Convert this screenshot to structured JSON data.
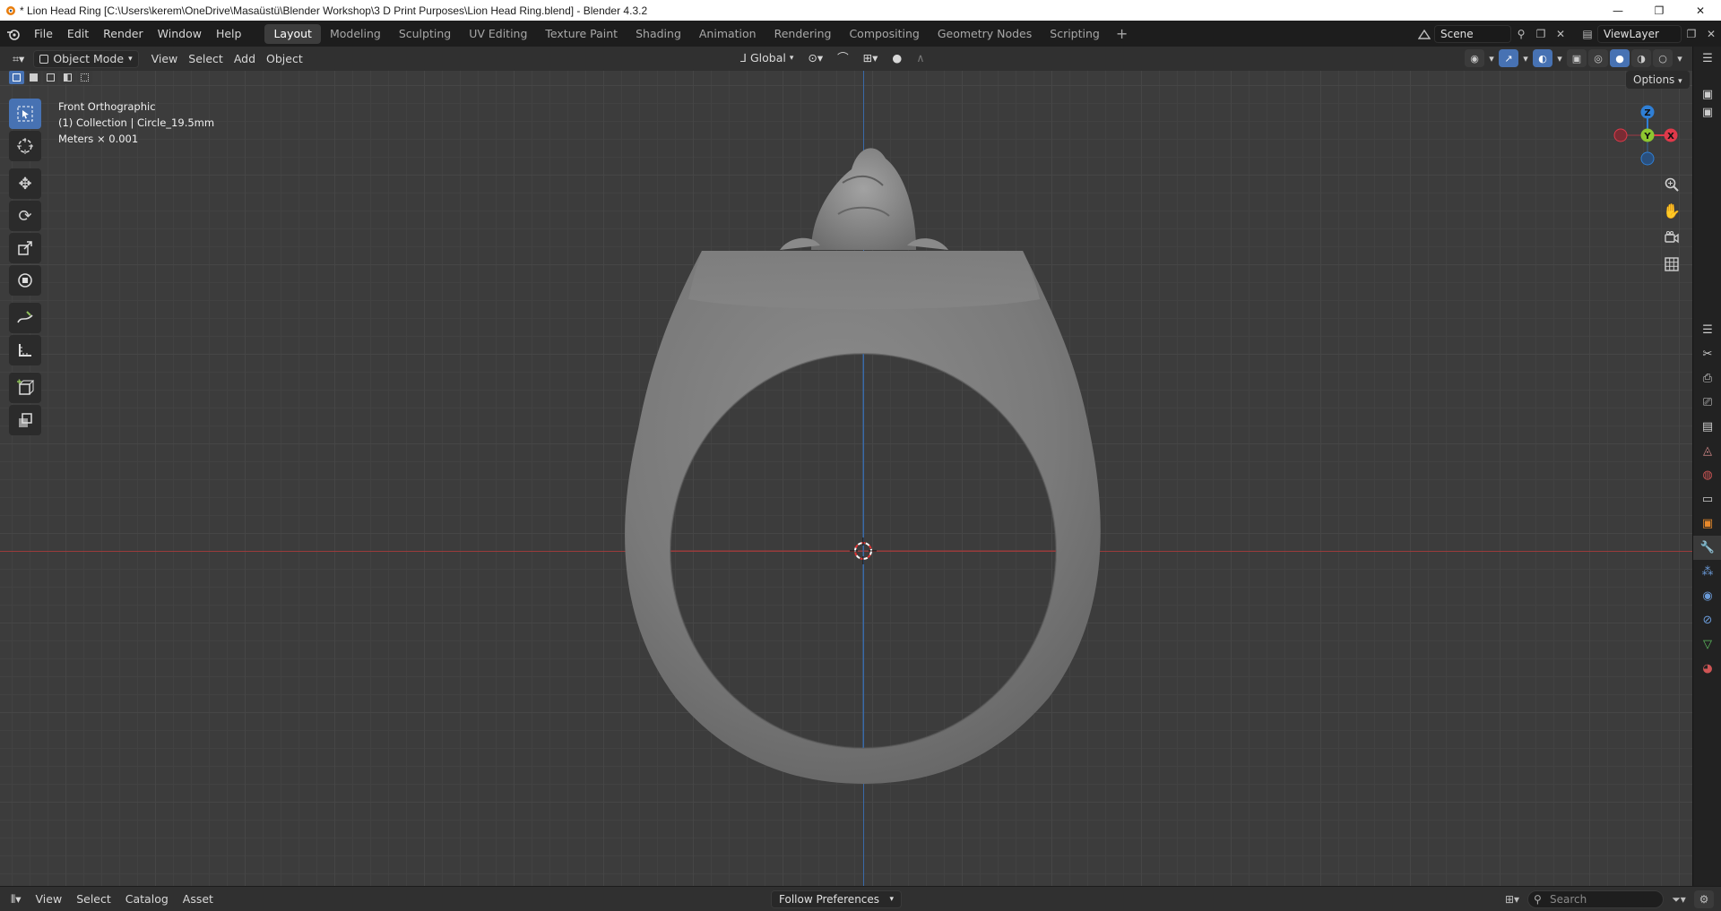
{
  "window": {
    "title": "* Lion Head Ring [C:\\Users\\kerem\\OneDrive\\Masaüstü\\Blender Workshop\\3 D Print Purposes\\Lion Head Ring.blend] - Blender 4.3.2",
    "controls": {
      "minimize": "—",
      "maximize": "❐",
      "close": "✕"
    }
  },
  "menu": {
    "items": [
      "File",
      "Edit",
      "Render",
      "Window",
      "Help"
    ]
  },
  "workspaces": {
    "tabs": [
      "Layout",
      "Modeling",
      "Sculpting",
      "UV Editing",
      "Texture Paint",
      "Shading",
      "Animation",
      "Rendering",
      "Compositing",
      "Geometry Nodes",
      "Scripting"
    ],
    "active": "Layout",
    "add": "+"
  },
  "scene": {
    "name": "Scene",
    "view_layer": "ViewLayer"
  },
  "viewport_header": {
    "mode": "Object Mode",
    "menus": [
      "View",
      "Select",
      "Add",
      "Object"
    ],
    "transform_orientation": "Global"
  },
  "viewport": {
    "view_name": "Front Orthographic",
    "collection": "(1) Collection | Circle_19.5mm",
    "units": "Meters × 0.001",
    "options_label": "Options",
    "gizmo_labels": {
      "z": "Z",
      "y": "Y",
      "x": "X"
    }
  },
  "bottom_bar": {
    "menus": [
      "View",
      "Select",
      "Catalog",
      "Asset"
    ],
    "import_method": "Follow Preferences",
    "search_placeholder": "Search"
  },
  "colors": {
    "accent": "#4772b3",
    "x_axis": "#9a3b3b",
    "z_axis": "#3a6aa8",
    "gizmo_x": "#e0394a",
    "gizmo_y": "#8dc730",
    "gizmo_z": "#2f7fd6",
    "object": "#7c7c7c"
  }
}
